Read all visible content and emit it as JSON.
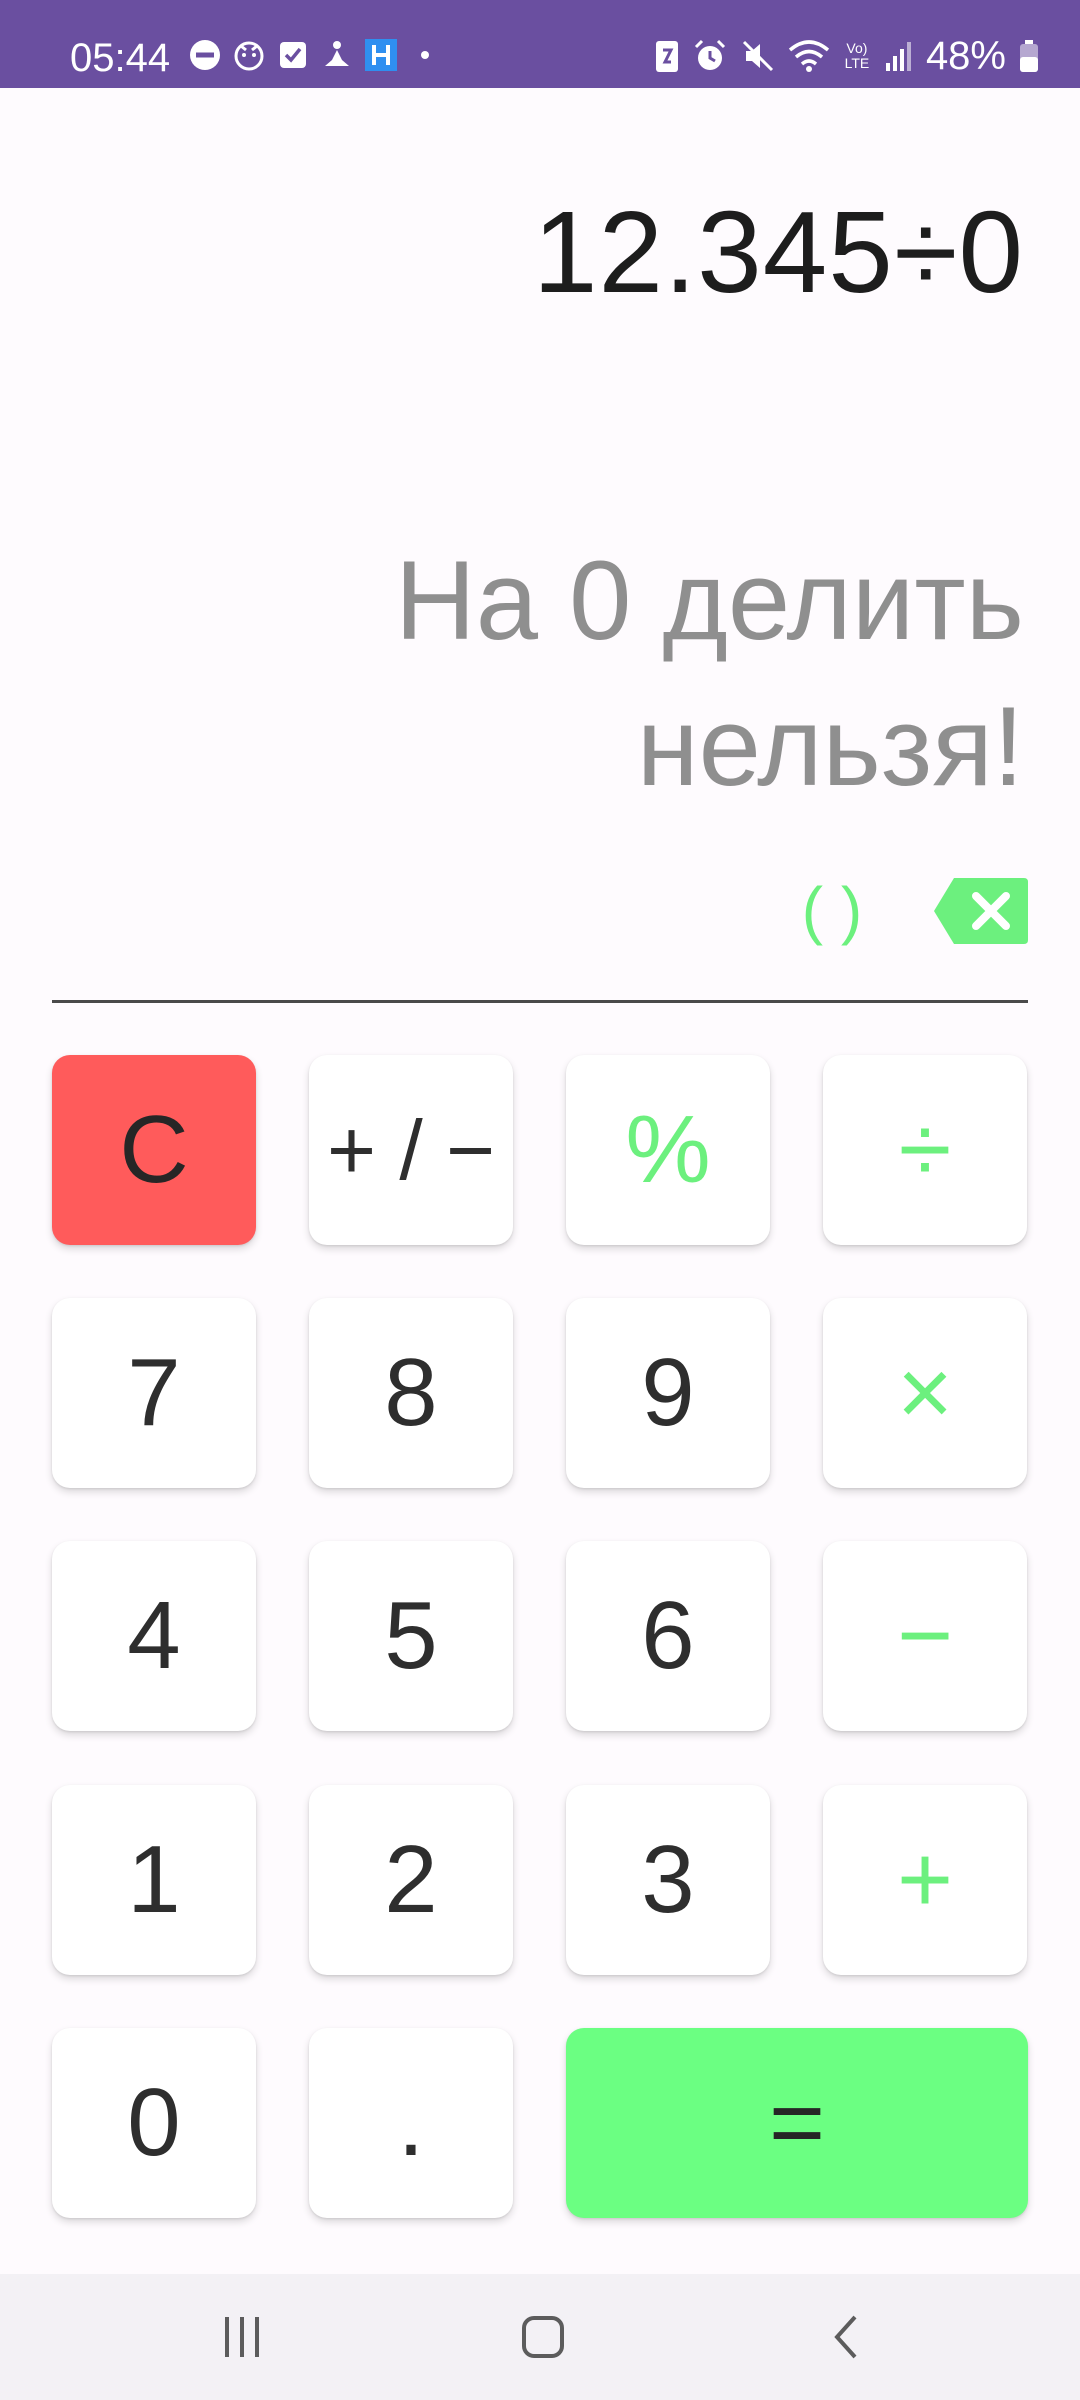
{
  "status_bar": {
    "time": "05:44",
    "battery": "48%",
    "left_icons": [
      "do-not-disturb-icon",
      "face-app-icon",
      "checkbox-app-icon",
      "meditation-app-icon",
      "h-app-icon",
      "dot-icon"
    ],
    "right_icons": [
      "battery-saver-icon",
      "alarm-icon",
      "mute-icon",
      "wifi-icon",
      "volte-icon",
      "signal-icon",
      "battery-icon"
    ],
    "volte_label": "Vo) LTE"
  },
  "display": {
    "expression": "12.345÷0",
    "result_line1": "На 0 делить",
    "result_line2": "нельзя!"
  },
  "controls": {
    "parentheses": "( )",
    "backspace_icon": "backspace-icon"
  },
  "keypad": {
    "clear": "C",
    "sign": "+ / −",
    "percent": "%",
    "divide": "÷",
    "seven": "7",
    "eight": "8",
    "nine": "9",
    "multiply": "×",
    "four": "4",
    "five": "5",
    "six": "6",
    "minus": "−",
    "one": "1",
    "two": "2",
    "three": "3",
    "plus": "+",
    "zero": "0",
    "dot": ".",
    "equals": "="
  },
  "colors": {
    "status_bar": "#6a4fa0",
    "accent_green": "#6cf07e",
    "equals_bg": "#6bff82",
    "clear_bg": "#ff5b5b",
    "result_text": "#8f8f8f"
  },
  "nav_bar": {
    "icons": [
      "recent-apps-icon",
      "home-icon",
      "back-icon"
    ]
  }
}
